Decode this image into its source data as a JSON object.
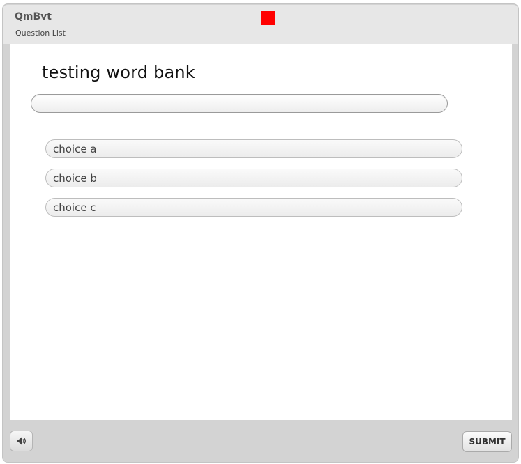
{
  "header": {
    "app_title": "QmBvt",
    "question_list_label": "Question List",
    "status_color": "#ff0000"
  },
  "question": {
    "title": "testing word bank",
    "answer_value": ""
  },
  "choices": [
    {
      "label": "choice a"
    },
    {
      "label": "choice b"
    },
    {
      "label": "choice c"
    }
  ],
  "footer": {
    "audio_icon": "speaker-icon",
    "submit_label": "SUBMIT"
  }
}
